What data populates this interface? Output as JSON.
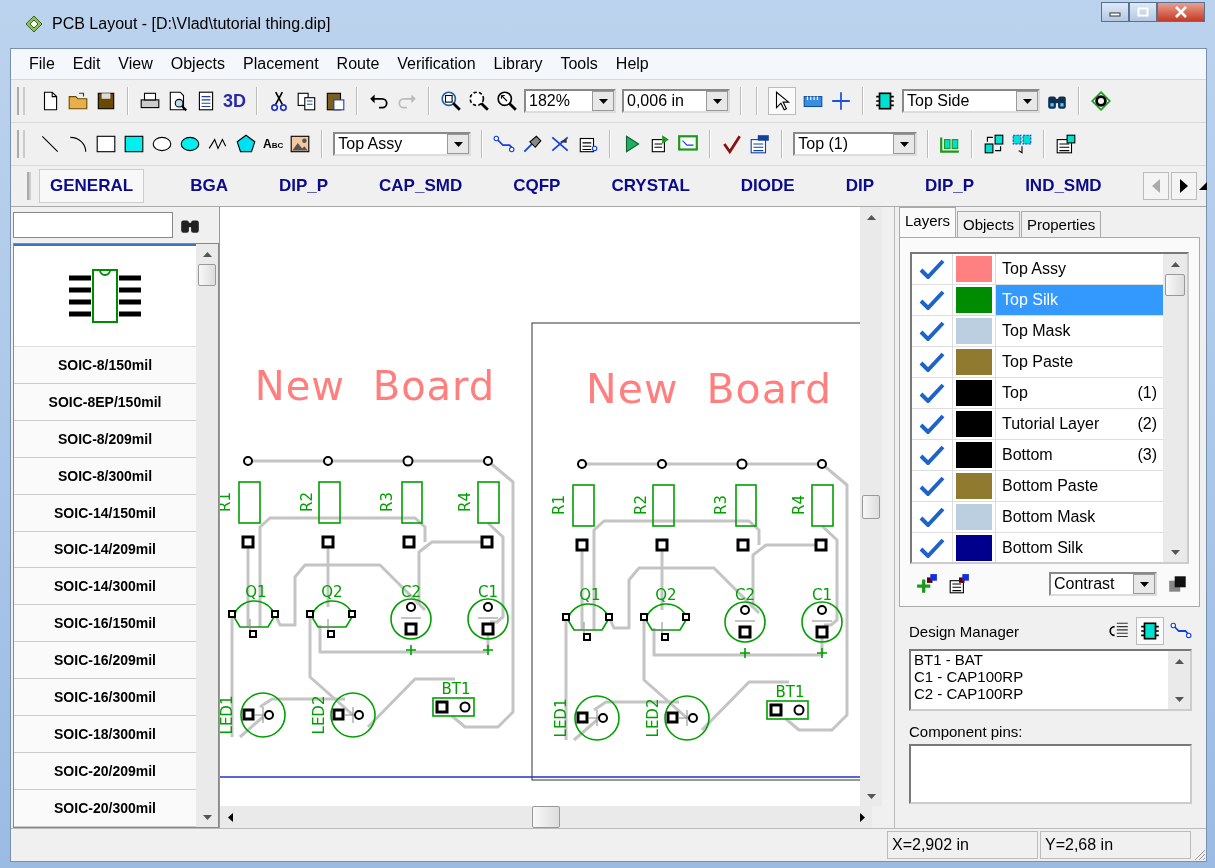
{
  "window": {
    "title": "PCB Layout - [D:\\Vlad\\tutorial thing.dip]"
  },
  "menu": [
    "File",
    "Edit",
    "View",
    "Objects",
    "Placement",
    "Route",
    "Verification",
    "Library",
    "Tools",
    "Help"
  ],
  "toolbar_1": {
    "view_3d": "3D",
    "zoom": "182%",
    "grid": "0,006 in",
    "side": "Top Side",
    "pointer_selected": true
  },
  "toolbar_2": {
    "text_tool": "Abc",
    "layer": "Top Assy",
    "route_layer": "Top (1)"
  },
  "library_tabs": [
    {
      "label": "GENERAL",
      "selected": true
    },
    {
      "label": "BGA",
      "selected": false
    },
    {
      "label": "DIP_P",
      "selected": false
    },
    {
      "label": "CAP_SMD",
      "selected": false
    },
    {
      "label": "CQFP",
      "selected": false
    },
    {
      "label": "CRYSTAL",
      "selected": false
    },
    {
      "label": "DIODE",
      "selected": false
    },
    {
      "label": "DIP",
      "selected": false
    },
    {
      "label": "DIP_P",
      "selected": false
    },
    {
      "label": "IND_SMD",
      "selected": false
    }
  ],
  "library": {
    "components": [
      {
        "name": "SOIC-8/150mil",
        "selected": false
      },
      {
        "name": "SOIC-8EP/150mil",
        "selected": false
      },
      {
        "name": "SOIC-8/209mil",
        "selected": false
      },
      {
        "name": "SOIC-8/300mil",
        "selected": false
      },
      {
        "name": "SOIC-14/150mil",
        "selected": false
      },
      {
        "name": "SOIC-14/209mil",
        "selected": false
      },
      {
        "name": "SOIC-14/300mil",
        "selected": false
      },
      {
        "name": "SOIC-16/150mil",
        "selected": false
      },
      {
        "name": "SOIC-16/209mil",
        "selected": false
      },
      {
        "name": "SOIC-16/300mil",
        "selected": false
      },
      {
        "name": "SOIC-18/300mil",
        "selected": false
      },
      {
        "name": "SOIC-20/209mil",
        "selected": false
      },
      {
        "name": "SOIC-20/300mil",
        "selected": false
      }
    ]
  },
  "boards": [
    {
      "title": "New Board",
      "labels": [
        "R1",
        "R2",
        "R3",
        "R4",
        "Q1",
        "Q2",
        "C2",
        "C1",
        "LED1",
        "LED2",
        "BT1"
      ]
    },
    {
      "title": "New Board",
      "labels": [
        "R1",
        "R2",
        "R3",
        "R4",
        "Q1",
        "Q2",
        "C2",
        "C1",
        "LED1",
        "LED2",
        "BT1"
      ]
    }
  ],
  "panel_tabs": [
    {
      "label": "Layers",
      "selected": true
    },
    {
      "label": "Objects",
      "selected": false
    },
    {
      "label": "Properties",
      "selected": false
    }
  ],
  "layers": [
    {
      "name": "Top Assy",
      "color": "#ff8080",
      "checked": true,
      "selected": false
    },
    {
      "name": "Top Silk",
      "color": "#008c00",
      "checked": true,
      "selected": true
    },
    {
      "name": "Top Mask",
      "color": "#bccfe0",
      "checked": true,
      "selected": false
    },
    {
      "name": "Top Paste",
      "color": "#8f7a30",
      "checked": true,
      "selected": false
    },
    {
      "name": "Top",
      "color": "#000000",
      "number": "(1)",
      "checked": true,
      "selected": false
    },
    {
      "name": "Tutorial Layer",
      "color": "#000000",
      "number": "(2)",
      "checked": true,
      "selected": false
    },
    {
      "name": "Bottom",
      "color": "#000000",
      "number": "(3)",
      "checked": true,
      "selected": false
    },
    {
      "name": "Bottom Paste",
      "color": "#8f7a30",
      "checked": true,
      "selected": false
    },
    {
      "name": "Bottom Mask",
      "color": "#bccfe0",
      "checked": true,
      "selected": false
    },
    {
      "name": "Bottom Silk",
      "color": "#00008c",
      "checked": true,
      "selected": false
    }
  ],
  "layer_mode": "Contrast",
  "design_manager": {
    "title": "Design Manager",
    "components_view_selected": true,
    "entries": [
      "BT1 - BAT",
      "C1 - CAP100RP",
      "C2 - CAP100RP"
    ],
    "pins_label": "Component pins:"
  },
  "status_bar": {
    "x": "X=2,902 in",
    "y": "Y=2,68 in"
  }
}
